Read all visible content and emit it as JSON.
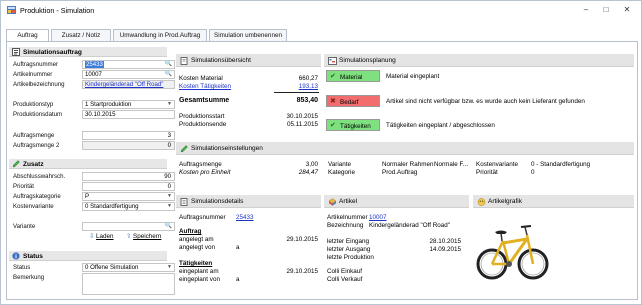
{
  "window": {
    "title": "Produktion - Simulation",
    "minimize": "–",
    "maximize": "□",
    "close": "✕"
  },
  "tabs": [
    "Auftrag",
    "Zusatz / Notiz",
    "Umwandlung in Prod.Auftrag",
    "Simulation umbenennen"
  ],
  "left": {
    "simulationsauftrag": {
      "header": "Simulationsauftrag",
      "fields": [
        {
          "label": "Auftragsnummer",
          "value": "25433"
        },
        {
          "label": "Artikelnummer",
          "value": "10007"
        },
        {
          "label": "Artikelbezeichnung",
          "value": "Kindergeländerad \"Off Road\""
        },
        {
          "label": "Produktionstyp",
          "value": "1 Startproduktion"
        },
        {
          "label": "Produktionsdatum",
          "value": "30.10.2015"
        },
        {
          "label": "Auftragsmenge",
          "value": "3"
        },
        {
          "label": "Auftragsmenge 2",
          "value": "0"
        }
      ]
    },
    "zusatz": {
      "header": "Zusatz",
      "fields": [
        {
          "label": "Abschlusswahrsch.",
          "value": "90"
        },
        {
          "label": "Priorität",
          "value": "0"
        },
        {
          "label": "Auftragskategorie",
          "value": "P"
        },
        {
          "label": "Kostenvariante",
          "value": "0 Standardfertigung"
        }
      ],
      "variante_label": "Variante",
      "laden": "Laden",
      "speichern": "Speichern"
    },
    "status": {
      "header": "Status",
      "fields": [
        {
          "label": "Status",
          "value": "0 Offene Simulation"
        },
        {
          "label": "Bemerkung",
          "value": ""
        }
      ]
    }
  },
  "uebersicht": {
    "header": "Simulationsübersicht",
    "kosten_material_label": "Kosten Material",
    "kosten_material": "660,27",
    "kosten_taetigkeiten_label": "Kosten Tätigkeiten",
    "kosten_taetigkeiten": "193,13",
    "gesamtsumme_label": "Gesamtsumme",
    "gesamtsumme": "853,40",
    "produktionsstart_label": "Produktionsstart",
    "produktionsstart": "30.10.2015",
    "produktionsende_label": "Produktionsende",
    "produktionsende": "05.11.2015"
  },
  "planung": {
    "header": "Simulationsplanung",
    "items": [
      {
        "label": "Material",
        "text": "Material eingeplant",
        "color": "#7ee07e"
      },
      {
        "label": "Bedarf",
        "text": "Artikel sind nicht verfügbar bzw. es wurde auch kein Lieferant gefunden",
        "color": "#f26d6d"
      },
      {
        "label": "Tätigkeiten",
        "text": "Tätigkeiten eingeplant / abgeschlossen",
        "color": "#7ee07e"
      }
    ]
  },
  "einstellungen": {
    "header": "Simulationseinstellungen",
    "auftragsmenge_label": "Auftragsmenge",
    "auftragsmenge": "3,00",
    "kosten_pro_einheit_label": "Kosten pro Einheit",
    "kosten_pro_einheit": "284,47",
    "variante_label": "Variante",
    "variante_1": "Normaler Rahmen",
    "variante_2": "Normale F...",
    "kategorie_label": "Kategorie",
    "kategorie": "Prod.Auftrag",
    "kostenvariante_label": "Kostenvariante",
    "kostenvariante": "0 - Standardfertigung",
    "prioritaet_label": "Priorität",
    "prioritaet": "0"
  },
  "details": {
    "header": "Simulationsdetails",
    "auftragsnummer_label": "Auftragsnummer",
    "auftragsnummer": "25433",
    "auftrag_heading": "Auftrag",
    "angelegt_am_label": "angelegt am",
    "angelegt_am": "29.10.2015",
    "angelegt_von_label": "angelegt von",
    "angelegt_von": "a",
    "taetigkeiten_heading": "Tätigkeiten",
    "eingeplant_am_label": "eingeplant am",
    "eingeplant_am": "29.10.2015",
    "eingeplant_von_label": "eingeplant von",
    "eingeplant_von": "a"
  },
  "artikel": {
    "header": "Artikel",
    "artikelnummer_label": "Artikelnummer",
    "artikelnummer": "10007",
    "bezeichnung_label": "Bezeichnung",
    "bezeichnung": "Kindergeländerad \"Off Road\"",
    "letzter_eingang_label": "letzter Eingang",
    "letzter_eingang": "28.10.2015",
    "letzter_ausgang_label": "letzter Ausgang",
    "letzter_ausgang": "14.09.2015",
    "letzte_produktion_label": "letzte Produktion",
    "colli_einkauf_label": "Colli Einkauf",
    "colli_verkauf_label": "Colli Verkauf"
  },
  "grafik": {
    "header": "Artikelgrafik"
  },
  "colors": {
    "accent_link": "#1d33c7",
    "ok_green": "#7ee07e",
    "error_red": "#f26d6d",
    "selection_blue": "#3b7ddd"
  }
}
